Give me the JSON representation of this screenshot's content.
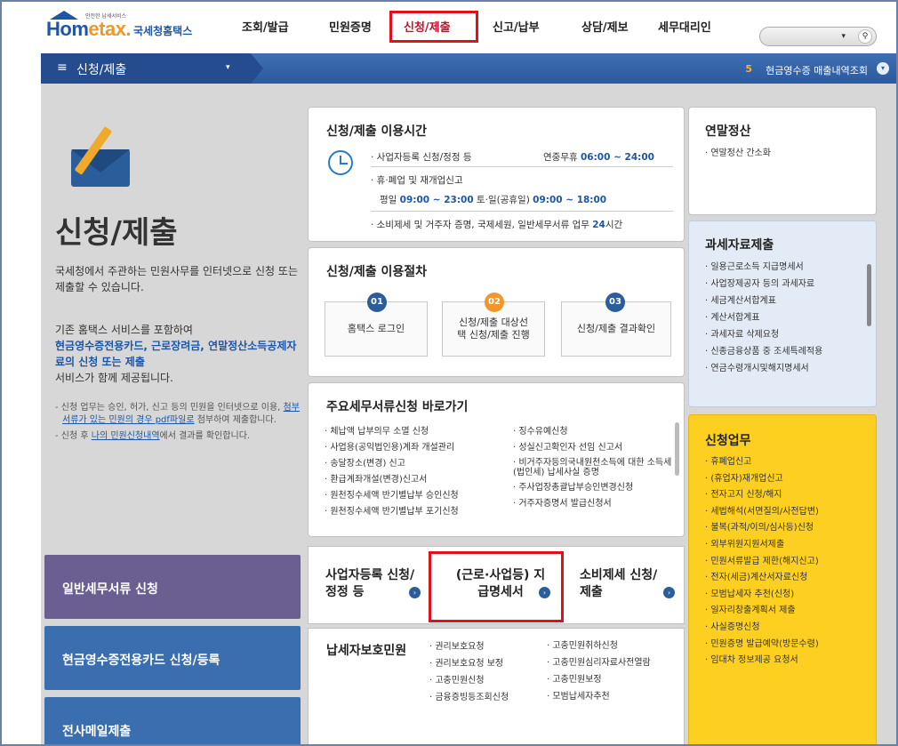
{
  "logo": {
    "brand_home": "Hom",
    "brand_tax": "etax.",
    "sub": "안전한 납세서비스",
    "name_kr": "국세청홈택스"
  },
  "menu": [
    {
      "label": "조회/발급"
    },
    {
      "label": "민원증명"
    },
    {
      "label": "신청/제출"
    },
    {
      "label": "신고/납부"
    },
    {
      "label": "상담/제보"
    },
    {
      "label": "세무대리인"
    }
  ],
  "search": {
    "dropdown": "▾",
    "icon": "search-icon"
  },
  "bar": {
    "burger": "≡",
    "crumb": "신청/제출",
    "crumb_dd": "▾",
    "ticker_num": "5",
    "ticker_text": "현금영수증 매출내역조회",
    "ticker_btn": "▾"
  },
  "hero": {
    "title": "신청/제출",
    "desc": "국세청에서 주관하는 민원사무를 인터넷으로 신청 또는 제출할 수 있습니다.",
    "desc2_pre": "기존 홈택스 서비스를 포함하여",
    "desc2_blue": "현금영수증전용카드, 근로장려금, 연말정산소득공제자료의 신청 또는 제출",
    "desc2_post": "서비스가 함께 제공됩니다.",
    "note1_pre": "- 신청 업무는 승인, 허가, 신고 등의 민원을 인터넷으로 이용, ",
    "note1_u": "첨부서류가 있는 민원의 경우 pdf파일로",
    "note1_post": " 첨부하여 제출합니다.",
    "note2_pre": "- 신청 후 ",
    "note2_u": "나의 민원신청내역",
    "note2_post": "에서 결과를 확인합니다."
  },
  "leftbuttons": [
    {
      "label": "일반세무서류 신청",
      "color": "#6b5e91"
    },
    {
      "label": "현금영수증전용카드 신청/등록",
      "color": "#3a6eae"
    },
    {
      "label": "전사메일제출",
      "color": "#3a6eae"
    }
  ],
  "hours": {
    "title": "신청/제출 이용시간",
    "l1": "· 사업자등록 신청/정정 등",
    "l1_right_pre": "연중무휴 ",
    "l1_right_b": "06:00 ~ 24:00",
    "l2": "· 휴·폐업 및 재개업신고",
    "l3_pre": "평일 ",
    "l3_b1": "09:00 ~ 23:00",
    "l3_mid": " 토·일(공휴일) ",
    "l3_b2": "09:00 ~ 18:00",
    "l4": "· 소비제세 및 거주자 증명, 국제세원, 일반세무서류 업무 ",
    "l4_b": "24",
    "l4_post": "시간"
  },
  "procedure": {
    "title": "신청/제출 이용절차",
    "steps": [
      {
        "num": "01",
        "label": "홈택스 로그인",
        "color": "#2a5d9a"
      },
      {
        "num": "02",
        "label": "신청/제출 대상선택 신청/제출 진행",
        "color": "#f0962a"
      },
      {
        "num": "03",
        "label": "신청/제출 결과확인",
        "color": "#2a5d9a"
      }
    ]
  },
  "shortcuts": {
    "title": "주요세무서류신청 바로가기",
    "left": [
      "· 체납액 납부의무 소멸 신청",
      "· 사업용(공익법인용)계좌 개설관리",
      "· 송달장소(변경) 신고",
      "· 환급계좌개설(변경)신고서",
      "· 원천징수세액 반기별납부 승인신청",
      "· 원천징수세액 반기별납부 포기신청"
    ],
    "right": [
      "· 징수유예신청",
      "· 성실신고확인자 선임 신고서",
      "· 비거주자등의국내원천소득에 대한 소득세(법인세) 납세사실 증명",
      "· 주사업장총괄납부승인변경신청",
      "· 거주자증명서 발급신청서"
    ]
  },
  "tri": [
    {
      "label": "사업자등록 신청/정정 등"
    },
    {
      "label": "(근로·사업등) 지급명세서"
    },
    {
      "label": "소비제세 신청/제출"
    }
  ],
  "protect": {
    "title": "납세자보호민원",
    "col1": [
      "· 권리보호요청",
      "· 권리보호요청 보정",
      "· 고충민원신청",
      "· 금융증빙등조회신청"
    ],
    "col2": [
      "· 고충민원취하신청",
      "· 고충민원심리자료사전열람",
      "· 고충민원보정",
      "· 모범납세자추천"
    ]
  },
  "yearend": {
    "title": "연말정산",
    "items": [
      "· 연말정산 간소화"
    ]
  },
  "taxdata": {
    "title": "과세자료제출",
    "items": [
      "· 일용근로소득 지급명세서",
      "· 사업장제공자 등의 과세자료",
      "· 세금계산서합계표",
      "· 계산서합계표",
      "· 과세자료 삭제요청",
      "· 신종금융상품 중 조세특례적용",
      "· 연금수령개시및해지명세서"
    ]
  },
  "apply": {
    "title": "신청업무",
    "items": [
      "· 휴폐업신고",
      "· (휴업자)재개업신고",
      "· 전자고지 신청/해지",
      "· 세법해석(서면질의/사전답변)",
      "· 불복(과적/이의/심사등)신청",
      "· 외부위원지원서제출",
      "· 민원서류발급 제한(해지신고)",
      "· 전자(세금)계산서자료신청",
      "· 모범납세자 추천(신청)",
      "· 일자리창출계획서 제출",
      "· 사실증명신청",
      "· 민원증명 발급예약(방문수령)",
      "· 임대차 정보제공 요청서"
    ]
  }
}
